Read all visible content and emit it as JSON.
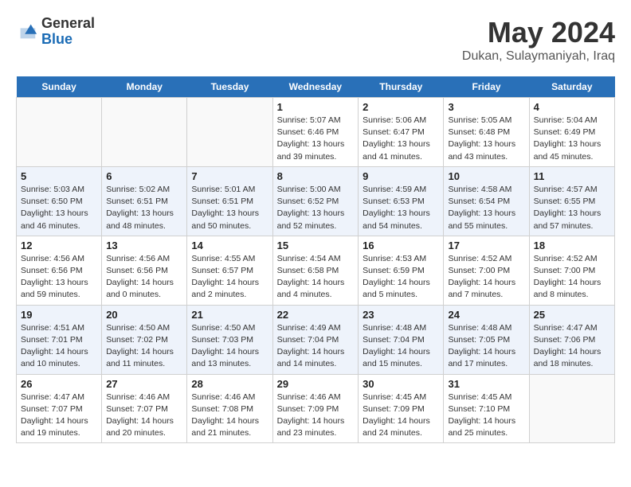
{
  "header": {
    "logo_general": "General",
    "logo_blue": "Blue",
    "month": "May 2024",
    "location": "Dukan, Sulaymaniyah, Iraq"
  },
  "calendar": {
    "weekdays": [
      "Sunday",
      "Monday",
      "Tuesday",
      "Wednesday",
      "Thursday",
      "Friday",
      "Saturday"
    ],
    "weeks": [
      [
        {
          "day": "",
          "info": ""
        },
        {
          "day": "",
          "info": ""
        },
        {
          "day": "",
          "info": ""
        },
        {
          "day": "1",
          "info": "Sunrise: 5:07 AM\nSunset: 6:46 PM\nDaylight: 13 hours\nand 39 minutes."
        },
        {
          "day": "2",
          "info": "Sunrise: 5:06 AM\nSunset: 6:47 PM\nDaylight: 13 hours\nand 41 minutes."
        },
        {
          "day": "3",
          "info": "Sunrise: 5:05 AM\nSunset: 6:48 PM\nDaylight: 13 hours\nand 43 minutes."
        },
        {
          "day": "4",
          "info": "Sunrise: 5:04 AM\nSunset: 6:49 PM\nDaylight: 13 hours\nand 45 minutes."
        }
      ],
      [
        {
          "day": "5",
          "info": "Sunrise: 5:03 AM\nSunset: 6:50 PM\nDaylight: 13 hours\nand 46 minutes."
        },
        {
          "day": "6",
          "info": "Sunrise: 5:02 AM\nSunset: 6:51 PM\nDaylight: 13 hours\nand 48 minutes."
        },
        {
          "day": "7",
          "info": "Sunrise: 5:01 AM\nSunset: 6:51 PM\nDaylight: 13 hours\nand 50 minutes."
        },
        {
          "day": "8",
          "info": "Sunrise: 5:00 AM\nSunset: 6:52 PM\nDaylight: 13 hours\nand 52 minutes."
        },
        {
          "day": "9",
          "info": "Sunrise: 4:59 AM\nSunset: 6:53 PM\nDaylight: 13 hours\nand 54 minutes."
        },
        {
          "day": "10",
          "info": "Sunrise: 4:58 AM\nSunset: 6:54 PM\nDaylight: 13 hours\nand 55 minutes."
        },
        {
          "day": "11",
          "info": "Sunrise: 4:57 AM\nSunset: 6:55 PM\nDaylight: 13 hours\nand 57 minutes."
        }
      ],
      [
        {
          "day": "12",
          "info": "Sunrise: 4:56 AM\nSunset: 6:56 PM\nDaylight: 13 hours\nand 59 minutes."
        },
        {
          "day": "13",
          "info": "Sunrise: 4:56 AM\nSunset: 6:56 PM\nDaylight: 14 hours\nand 0 minutes."
        },
        {
          "day": "14",
          "info": "Sunrise: 4:55 AM\nSunset: 6:57 PM\nDaylight: 14 hours\nand 2 minutes."
        },
        {
          "day": "15",
          "info": "Sunrise: 4:54 AM\nSunset: 6:58 PM\nDaylight: 14 hours\nand 4 minutes."
        },
        {
          "day": "16",
          "info": "Sunrise: 4:53 AM\nSunset: 6:59 PM\nDaylight: 14 hours\nand 5 minutes."
        },
        {
          "day": "17",
          "info": "Sunrise: 4:52 AM\nSunset: 7:00 PM\nDaylight: 14 hours\nand 7 minutes."
        },
        {
          "day": "18",
          "info": "Sunrise: 4:52 AM\nSunset: 7:00 PM\nDaylight: 14 hours\nand 8 minutes."
        }
      ],
      [
        {
          "day": "19",
          "info": "Sunrise: 4:51 AM\nSunset: 7:01 PM\nDaylight: 14 hours\nand 10 minutes."
        },
        {
          "day": "20",
          "info": "Sunrise: 4:50 AM\nSunset: 7:02 PM\nDaylight: 14 hours\nand 11 minutes."
        },
        {
          "day": "21",
          "info": "Sunrise: 4:50 AM\nSunset: 7:03 PM\nDaylight: 14 hours\nand 13 minutes."
        },
        {
          "day": "22",
          "info": "Sunrise: 4:49 AM\nSunset: 7:04 PM\nDaylight: 14 hours\nand 14 minutes."
        },
        {
          "day": "23",
          "info": "Sunrise: 4:48 AM\nSunset: 7:04 PM\nDaylight: 14 hours\nand 15 minutes."
        },
        {
          "day": "24",
          "info": "Sunrise: 4:48 AM\nSunset: 7:05 PM\nDaylight: 14 hours\nand 17 minutes."
        },
        {
          "day": "25",
          "info": "Sunrise: 4:47 AM\nSunset: 7:06 PM\nDaylight: 14 hours\nand 18 minutes."
        }
      ],
      [
        {
          "day": "26",
          "info": "Sunrise: 4:47 AM\nSunset: 7:07 PM\nDaylight: 14 hours\nand 19 minutes."
        },
        {
          "day": "27",
          "info": "Sunrise: 4:46 AM\nSunset: 7:07 PM\nDaylight: 14 hours\nand 20 minutes."
        },
        {
          "day": "28",
          "info": "Sunrise: 4:46 AM\nSunset: 7:08 PM\nDaylight: 14 hours\nand 21 minutes."
        },
        {
          "day": "29",
          "info": "Sunrise: 4:46 AM\nSunset: 7:09 PM\nDaylight: 14 hours\nand 23 minutes."
        },
        {
          "day": "30",
          "info": "Sunrise: 4:45 AM\nSunset: 7:09 PM\nDaylight: 14 hours\nand 24 minutes."
        },
        {
          "day": "31",
          "info": "Sunrise: 4:45 AM\nSunset: 7:10 PM\nDaylight: 14 hours\nand 25 minutes."
        },
        {
          "day": "",
          "info": ""
        }
      ]
    ]
  }
}
